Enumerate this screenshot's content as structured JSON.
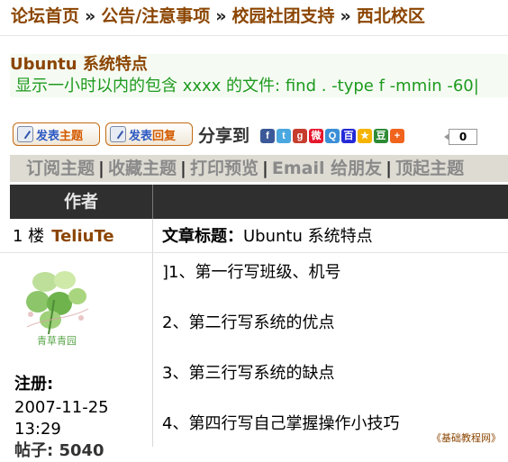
{
  "breadcrumb": {
    "items": [
      "论坛首页",
      "公告/注意事项",
      "校园社团支持",
      "西北校区"
    ],
    "separator": "»"
  },
  "topic": {
    "title": "Ubuntu 系统特点",
    "snippet": "显示一小时以内的包含 xxxx 的文件:  find . -type f -mmin -60|"
  },
  "actions": {
    "new_topic": {
      "part1": "发表",
      "part2": "主题"
    },
    "reply": {
      "part1": "发表",
      "part2": "回复"
    },
    "share_label": "分享到",
    "share_count": "0",
    "share_icons": [
      {
        "name": "facebook-icon",
        "glyph": "f",
        "color": "#3b5998"
      },
      {
        "name": "twitter-icon",
        "glyph": "t",
        "color": "#49a8e0"
      },
      {
        "name": "googleplus-icon",
        "glyph": "g",
        "color": "#c63d2d"
      },
      {
        "name": "weibo-icon",
        "glyph": "微",
        "color": "#e6162d"
      },
      {
        "name": "tqq-icon",
        "glyph": "Q",
        "color": "#3b8fd6"
      },
      {
        "name": "baidu-icon",
        "glyph": "百",
        "color": "#2529d8"
      },
      {
        "name": "qzone-icon",
        "glyph": "★",
        "color": "#f5b400"
      },
      {
        "name": "douban-icon",
        "glyph": "豆",
        "color": "#2e8b35"
      },
      {
        "name": "more-icon",
        "glyph": "+",
        "color": "#f0641e"
      }
    ]
  },
  "tools": [
    "订阅主题",
    "收藏主题",
    "打印预览",
    "Email 给朋友",
    "顶起主题"
  ],
  "table": {
    "author_header": "作者"
  },
  "post": {
    "floor": "1 楼",
    "username": "TeliuTe",
    "subject_label": "文章标题：",
    "subject": "Ubuntu 系统特点",
    "avatar_caption": "青草青园",
    "register_label": "注册:",
    "register_date": "2007-11-25",
    "register_time": "13:29",
    "posts_partial": "帖子: 5040",
    "lines": [
      "]1、第一行写班级、机号",
      "2、第二行写系统的优点",
      "3、第三行写系统的缺点",
      "4、第四行写自己掌握操作小技巧"
    ]
  },
  "watermark": "《基础教程网》"
}
